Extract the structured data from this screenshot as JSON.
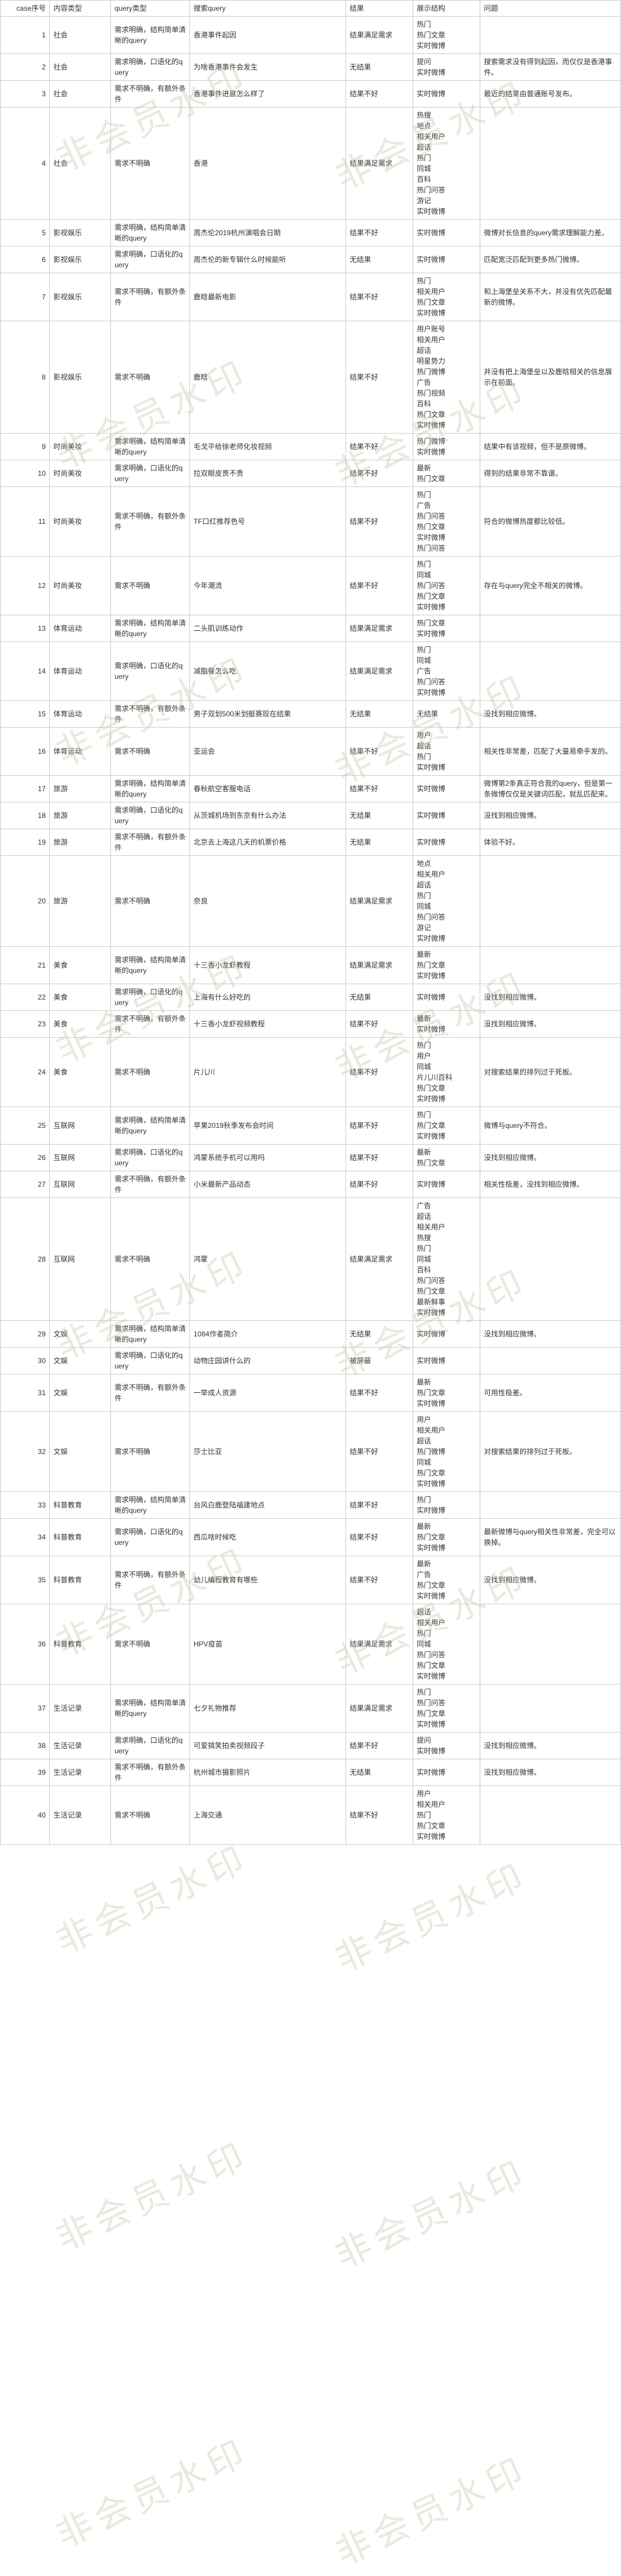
{
  "watermark_text": "非会员水印",
  "headers": {
    "idx": "case序号",
    "cat": "内容类型",
    "qt": "query类型",
    "q": "搜索query",
    "res": "结果",
    "disp": "展示结构",
    "issue": "问题"
  },
  "rows": [
    {
      "idx": "1",
      "cat": "社会",
      "qt": "需求明确，结构简单清晰的query",
      "q": "香港事件起因",
      "res": "结果满足需求",
      "disp": "热门\n热门文章\n实时微博",
      "issue": ""
    },
    {
      "idx": "2",
      "cat": "社会",
      "qt": "需求明确，口语化的query",
      "q": "为啥香港事件会发生",
      "res": "无结果",
      "disp": "提问\n实时微博",
      "issue": "搜索需求没有得到起因，而仅仅是香港事件。"
    },
    {
      "idx": "3",
      "cat": "社会",
      "qt": "需求不明确，有额外条件",
      "q": "香港事件进展怎么样了",
      "res": "结果不好",
      "disp": "实时微博",
      "issue": "最近的结果由普通账号发布。"
    },
    {
      "idx": "4",
      "cat": "社会",
      "qt": "需求不明确",
      "q": "香港",
      "res": "结果满足需求",
      "disp": "热搜\n地点\n相关用户\n超话\n热门\n同城\n百科\n热门问答\n游记\n实时微博",
      "issue": ""
    },
    {
      "idx": "5",
      "cat": "影视娱乐",
      "qt": "需求明确，结构简单清晰的query",
      "q": "周杰伦2019杭州演唱会日期",
      "res": "结果不好",
      "disp": "实时微博",
      "issue": "微博对长信息的query需求理解能力差。"
    },
    {
      "idx": "6",
      "cat": "影视娱乐",
      "qt": "需求明确，口语化的query",
      "q": "周杰伦的新专辑什么时候能听",
      "res": "无结果",
      "disp": "实时微博",
      "issue": "匹配宽泛匹配到更多热门微博。"
    },
    {
      "idx": "7",
      "cat": "影视娱乐",
      "qt": "需求不明确，有额外条件",
      "q": "鹿晗最新电影",
      "res": "结果不好",
      "disp": "热门\n相关用户\n热门文章\n实时微博",
      "issue": "和上海堡垒关系不大，并没有优先匹配最新的微博。"
    },
    {
      "idx": "8",
      "cat": "影视娱乐",
      "qt": "需求不明确",
      "q": "鹿晗",
      "res": "结果不好",
      "disp": "用户账号\n相关用户\n超话\n明星势力\n热门微博\n广告\n热门视频\n百科\n热门文章\n实时微博",
      "issue": "并没有把上海堡垒以及鹿晗相关的信息展示在前面。"
    },
    {
      "idx": "9",
      "cat": "时尚美妆",
      "qt": "需求明确，结构简单清晰的query",
      "q": "毛戈平给徐老师化妆视频",
      "res": "结果不好",
      "disp": "热门微博\n实时微博",
      "issue": "结果中有该视频，但不是原微博。"
    },
    {
      "idx": "10",
      "cat": "时尚美妆",
      "qt": "需求明确，口语化的query",
      "q": "拉双眼皮贵不贵",
      "res": "结果不好",
      "disp": "最新\n热门文章",
      "issue": "得到的结果非常不靠谱。"
    },
    {
      "idx": "11",
      "cat": "时尚美妆",
      "qt": "需求不明确，有额外条件",
      "q": "TF口红推荐色号",
      "res": "结果不好",
      "disp": "热门\n广告\n热门问答\n热门文章\n实时微博\n热门问答",
      "issue": "符合的微博热度都比较低。"
    },
    {
      "idx": "12",
      "cat": "时尚美妆",
      "qt": "需求不明确",
      "q": "今年潮流",
      "res": "结果不好",
      "disp": "热门\n同城\n热门问答\n热门文章\n实时微博",
      "issue": "存在与query完全不相关的微博。"
    },
    {
      "idx": "13",
      "cat": "体育运动",
      "qt": "需求明确，结构简单清晰的query",
      "q": "二头肌训练动作",
      "res": "结果满足需求",
      "disp": "热门文章\n实时微博",
      "issue": ""
    },
    {
      "idx": "14",
      "cat": "体育运动",
      "qt": "需求明确，口语化的query",
      "q": "减脂餐怎么吃",
      "res": "结果满足需求",
      "disp": "热门\n同城\n广告\n热门问答\n实时微博",
      "issue": ""
    },
    {
      "idx": "15",
      "cat": "体育运动",
      "qt": "需求不明确，有额外条件",
      "q": "男子双划500米划艇赛现在结果",
      "res": "无结果",
      "disp": "无结果",
      "issue": "没找到相应微博。"
    },
    {
      "idx": "16",
      "cat": "体育运动",
      "qt": "需求不明确",
      "q": "亚运会",
      "res": "结果不好",
      "disp": "用户\n超话\n热门\n实时微博",
      "issue": "相关性非常差，匹配了大量易牵手发的。"
    },
    {
      "idx": "17",
      "cat": "旅游",
      "qt": "需求明确，结构简单清晰的query",
      "q": "春秋航空客服电话",
      "res": "结果不好",
      "disp": "实时微博",
      "issue": "微博第2条真正符合我的query，但是第一条微博仅仅是关键词匹配，就乱匹配来。"
    },
    {
      "idx": "18",
      "cat": "旅游",
      "qt": "需求明确，口语化的query",
      "q": "从茨城机场到东京有什么办法",
      "res": "无结果",
      "disp": "实时微博",
      "issue": "没找到相应微博。"
    },
    {
      "idx": "19",
      "cat": "旅游",
      "qt": "需求不明确，有额外条件",
      "q": "北京去上海这几天的机票价格",
      "res": "无结果",
      "disp": "实时微博",
      "issue": "体验不好。"
    },
    {
      "idx": "20",
      "cat": "旅游",
      "qt": "需求不明确",
      "q": "奈良",
      "res": "结果满足需求",
      "disp": "地点\n相关用户\n超话\n热门\n同城\n热门问答\n游记\n实时微博",
      "issue": ""
    },
    {
      "idx": "21",
      "cat": "美食",
      "qt": "需求明确，结构简单清晰的query",
      "q": "十三香小龙虾教程",
      "res": "结果满足需求",
      "disp": "最新\n热门文章\n实时微博",
      "issue": ""
    },
    {
      "idx": "22",
      "cat": "美食",
      "qt": "需求明确，口语化的query",
      "q": "上海有什么好吃的",
      "res": "无结果",
      "disp": "实时微博",
      "issue": "没找到相应微博。"
    },
    {
      "idx": "23",
      "cat": "美食",
      "qt": "需求不明确，有额外条件",
      "q": "十三香小龙虾视频教程",
      "res": "结果不好",
      "disp": "最新\n实时微博",
      "issue": "没找到相应微博。"
    },
    {
      "idx": "24",
      "cat": "美食",
      "qt": "需求不明确",
      "q": "片儿川",
      "res": "结果不好",
      "disp": "热门\n用户\n同城\n片儿川百科\n热门文章\n实时微博",
      "issue": "对搜索结果的排列过于死板。"
    },
    {
      "idx": "25",
      "cat": "互联网",
      "qt": "需求明确，结构简单清晰的query",
      "q": "苹果2019秋季发布会时间",
      "res": "结果不好",
      "disp": "热门\n热门文章\n实时微博",
      "issue": "微博与query不符合。"
    },
    {
      "idx": "26",
      "cat": "互联网",
      "qt": "需求明确，口语化的query",
      "q": "鸿蒙系统手机可以用吗",
      "res": "结果不好",
      "disp": "最新\n热门文章",
      "issue": "没找到相应微博。"
    },
    {
      "idx": "27",
      "cat": "互联网",
      "qt": "需求不明确，有额外条件",
      "q": "小米最新产品动态",
      "res": "结果不好",
      "disp": "实时微博",
      "issue": "相关性极差，没找到相应微博。"
    },
    {
      "idx": "28",
      "cat": "互联网",
      "qt": "需求不明确",
      "q": "鸿蒙",
      "res": "结果满足需求",
      "disp": "广告\n超话\n相关用户\n热搜\n热门\n同城\n百科\n热门问答\n热门文章\n最新鲜事\n实时微博",
      "issue": ""
    },
    {
      "idx": "29",
      "cat": "文娱",
      "qt": "需求明确，结构简单清晰的query",
      "q": "1084作者简介",
      "res": "无结果",
      "disp": "实时微博",
      "issue": "没找到相应微博。"
    },
    {
      "idx": "30",
      "cat": "文娱",
      "qt": "需求明确，口语化的query",
      "q": "动物庄园讲什么的",
      "res": "被屏蔽",
      "disp": "实时微博",
      "issue": ""
    },
    {
      "idx": "31",
      "cat": "文娱",
      "qt": "需求不明确，有额外条件",
      "q": "一举成人资源",
      "res": "结果不好",
      "disp": "最新\n热门文章\n实时微博",
      "issue": "可用性极差。"
    },
    {
      "idx": "32",
      "cat": "文娱",
      "qt": "需求不明确",
      "q": "莎士比亚",
      "res": "结果不好",
      "disp": "用户\n相关用户\n超话\n热门微博\n同城\n热门文章\n实时微博",
      "issue": "对搜索结果的排列过于死板。"
    },
    {
      "idx": "33",
      "cat": "科普教育",
      "qt": "需求明确，结构简单清晰的query",
      "q": "台风白鹿登陆福建地点",
      "res": "结果不好",
      "disp": "热门\n实时微博",
      "issue": ""
    },
    {
      "idx": "34",
      "cat": "科普教育",
      "qt": "需求明确，口语化的query",
      "q": "西瓜啥时候吃",
      "res": "结果不好",
      "disp": "最新\n热门文章\n实时微博",
      "issue": "最新微博与query相关性非常差，完全可以换掉。"
    },
    {
      "idx": "35",
      "cat": "科普教育",
      "qt": "需求不明确，有额外条件",
      "q": "幼儿编程教育有哪些",
      "res": "结果不好",
      "disp": "最新\n广告\n热门文章\n实时微博",
      "issue": "没找到相应微博。"
    },
    {
      "idx": "36",
      "cat": "科普教育",
      "qt": "需求不明确",
      "q": "HPV疫苗",
      "res": "结果满足需求",
      "disp": "超话\n相关用户\n热门\n同城\n热门问答\n热门文章\n实时微博",
      "issue": ""
    },
    {
      "idx": "37",
      "cat": "生活记录",
      "qt": "需求明确，结构简单清晰的query",
      "q": "七夕礼物推荐",
      "res": "结果满足需求",
      "disp": "热门\n热门问答\n热门文章\n实时微博",
      "issue": ""
    },
    {
      "idx": "38",
      "cat": "生活记录",
      "qt": "需求明确，口语化的query",
      "q": "可爱搞笑拍卖视频段子",
      "res": "结果不好",
      "disp": "提问\n实时微博",
      "issue": "没找到相应微博。"
    },
    {
      "idx": "39",
      "cat": "生活记录",
      "qt": "需求不明确，有额外条件",
      "q": "杭州城市摄影照片",
      "res": "无结果",
      "disp": "实时微博",
      "issue": "没找到相应微博。"
    },
    {
      "idx": "40",
      "cat": "生活记录",
      "qt": "需求不明确",
      "q": "上海交通",
      "res": "结果不好",
      "disp": "用户\n相关用户\n热门\n热门文章\n实时微博",
      "issue": ""
    }
  ]
}
